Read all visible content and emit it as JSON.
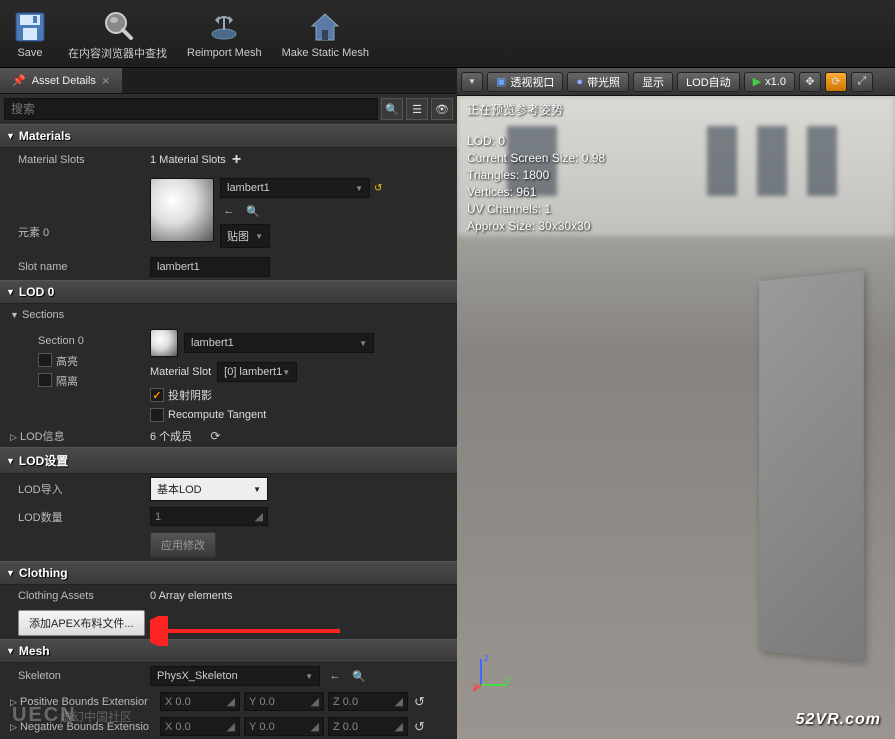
{
  "toolbar": {
    "save": "Save",
    "find": "在内容浏览器中查找",
    "reimport": "Reimport Mesh",
    "makestatic": "Make Static Mesh"
  },
  "tab": {
    "title": "Asset Details"
  },
  "search": {
    "placeholder": "搜索"
  },
  "materials": {
    "header": "Materials",
    "slots_label": "Material Slots",
    "slots_value": "1 Material Slots",
    "element_label": "元素 0",
    "mat_name": "lambert1",
    "texture_btn": "贴图",
    "slotname_label": "Slot name",
    "slotname_value": "lambert1"
  },
  "lod0": {
    "header": "LOD 0",
    "sections": "Sections",
    "section0": "Section 0",
    "highlight": "高亮",
    "isolate": "隔离",
    "mat_name": "lambert1",
    "matslot_label": "Material Slot",
    "matslot_value": "[0] lambert1",
    "castshadow": "投射阴影",
    "recompute": "Recompute Tangent",
    "lodinfo": "LOD信息",
    "members": "6 个成员"
  },
  "lodsettings": {
    "header": "LOD设置",
    "import_label": "LOD导入",
    "import_value": "基本LOD",
    "count_label": "LOD数量",
    "count_value": "1",
    "apply": "应用修改"
  },
  "clothing": {
    "header": "Clothing",
    "assets_label": "Clothing Assets",
    "assets_value": "0 Array elements",
    "add_btn": "添加APEX布料文件..."
  },
  "mesh": {
    "header": "Mesh",
    "skeleton_label": "Skeleton",
    "skeleton_value": "PhysX_Skeleton",
    "posbounds": "Positive Bounds Extensior",
    "negbounds": "Negative Bounds Extensio",
    "x": "X",
    "y": "Y",
    "z": "Z",
    "zero": "0.0"
  },
  "viewport": {
    "btn_perspective": "透视视口",
    "btn_lit": "带光照",
    "btn_show": "显示",
    "btn_lodauto": "LOD自动",
    "btn_x1": "x1.0",
    "status_preview": "正在预览参考姿势",
    "lod": "LOD: 0",
    "screensize": "Current Screen Size: 0.98",
    "triangles": "Triangles: 1800",
    "vertices": "Vertices: 961",
    "uvchannels": "UV Channels: 1",
    "approx": "Approx Size: 30x30x30",
    "gizmo_x": "x",
    "gizmo_y": "y",
    "gizmo_z": "z"
  },
  "watermark": "52VR.com",
  "watermark2": "UECN",
  "watermark2b": "虚幻中国社区"
}
